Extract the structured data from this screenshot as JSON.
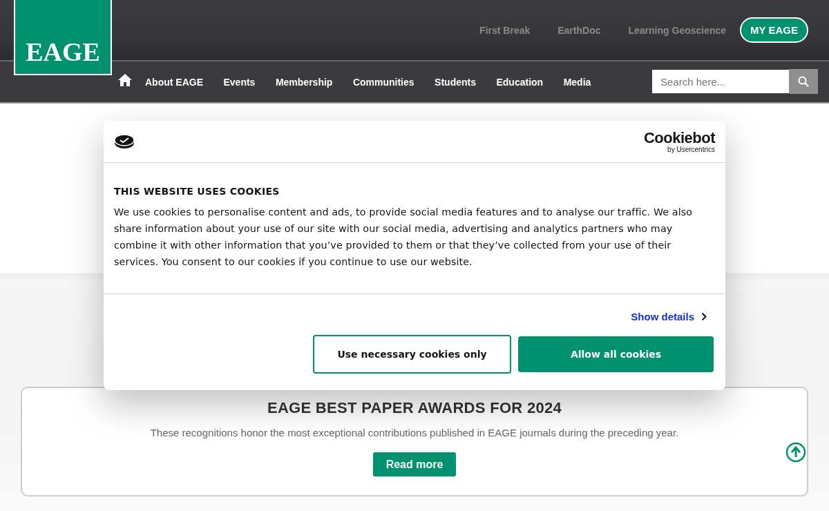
{
  "header": {
    "logo": "EAGE",
    "top_links": [
      {
        "label": "First Break"
      },
      {
        "label": "EarthDoc"
      },
      {
        "label": "Learning Geoscience"
      }
    ],
    "account_button": "MY EAGE",
    "nav": [
      {
        "label": "About EAGE"
      },
      {
        "label": "Events"
      },
      {
        "label": "Membership"
      },
      {
        "label": "Communities"
      },
      {
        "label": "Students"
      },
      {
        "label": "Education"
      },
      {
        "label": "Media"
      }
    ],
    "search": {
      "placeholder": "Search here..."
    }
  },
  "cookie_dialog": {
    "brand": "Cookiebot",
    "brand_sub": "by Usercentrics",
    "title": "THIS WEBSITE USES COOKIES",
    "body": "We use cookies to personalise content and ads, to provide social media features and to analyse our traffic. We also share information about your use of our site with our social media, advertising and analytics partners who may combine it with other information that you’ve provided to them or that they’ve collected from your use of their services. You consent to our cookies if you continue to use our website.",
    "details_link": "Show details",
    "buttons": [
      {
        "label": "Use necessary cookies only",
        "kind": "outline"
      },
      {
        "label": "Allow all cookies",
        "kind": "filled"
      }
    ]
  },
  "award_card": {
    "title": "EAGE BEST PAPER AWARDS FOR 2024",
    "text": "These recognitions honor the most exceptional contributions published in EAGE journals during the preceding year.",
    "button": "Read more"
  }
}
